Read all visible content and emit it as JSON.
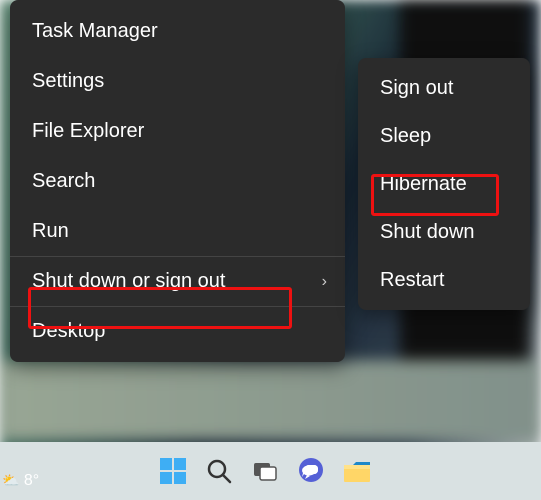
{
  "weather": {
    "temp": "8°"
  },
  "main_menu": {
    "items": [
      {
        "label": "Task Manager"
      },
      {
        "label": "Settings"
      },
      {
        "label": "File Explorer"
      },
      {
        "label": "Search"
      },
      {
        "label": "Run"
      },
      {
        "label": "Shut down or sign out",
        "has_submenu": true
      },
      {
        "label": "Desktop"
      }
    ]
  },
  "sub_menu": {
    "items": [
      {
        "label": "Sign out"
      },
      {
        "label": "Sleep"
      },
      {
        "label": "Hibernate"
      },
      {
        "label": "Shut down"
      },
      {
        "label": "Restart"
      }
    ]
  },
  "taskbar": {
    "icons": [
      "start",
      "search",
      "task-view",
      "chat",
      "file-explorer"
    ]
  },
  "highlight": {
    "main_index": 5,
    "sub_index": 2
  }
}
